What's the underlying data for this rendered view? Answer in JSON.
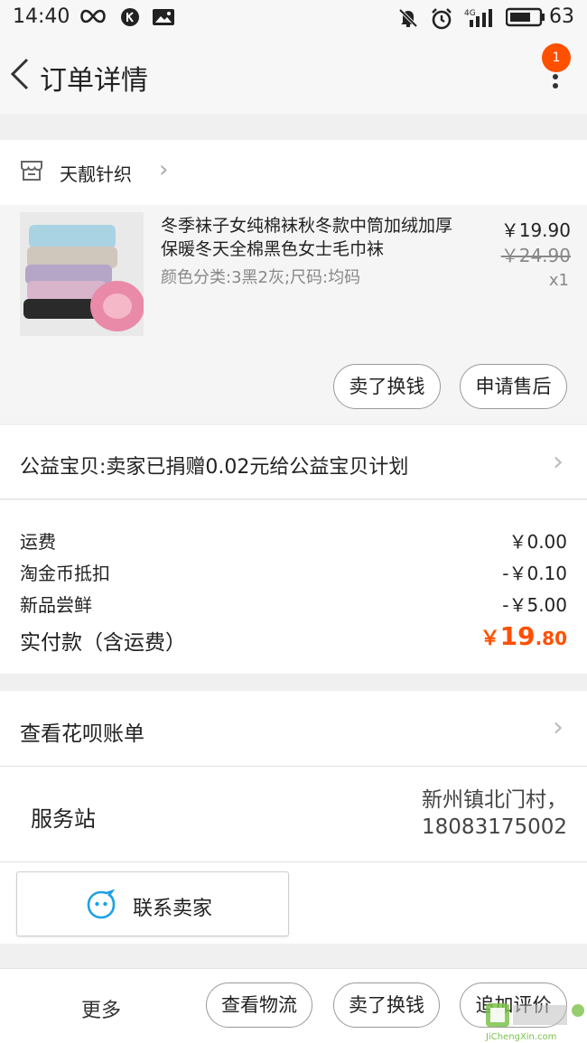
{
  "status_bar": {
    "time": "14:40",
    "battery": "63",
    "icons": [
      "infinity-icon",
      "k-circle-icon",
      "image-notification-icon",
      "mute-bell-icon",
      "alarm-icon",
      "signal-4g-icon",
      "battery-icon"
    ]
  },
  "nav": {
    "title": "订单详情",
    "back_icon": "chevron-left-icon",
    "more_icon": "more-vertical-icon",
    "badge_count": "1"
  },
  "shop": {
    "name": "天靓针织",
    "icon": "store-icon"
  },
  "item": {
    "title": "冬季袜子女纯棉袜秋冬款中筒加绒加厚保暖冬天全棉黑色女士毛巾袜",
    "sku": "颜色分类:3黑2灰;尺码:均码",
    "price": "￥19.90",
    "original_price": "￥24.90",
    "quantity": "x1",
    "buttons": [
      "卖了换钱",
      "申请售后"
    ]
  },
  "charity": {
    "text": "公益宝贝:卖家已捐赠0.02元给公益宝贝计划"
  },
  "fees": {
    "rows": [
      {
        "label": "运费",
        "value": "￥0.00"
      },
      {
        "label": "淘金币抵扣",
        "value": "-￥0.10"
      },
      {
        "label": "新品尝鲜",
        "value": "-￥5.00"
      }
    ],
    "total_label": "实付款（含运费）",
    "total_currency": "￥",
    "total_int": "19",
    "total_dec": ".80"
  },
  "huabei": {
    "text": "查看花呗账单"
  },
  "station": {
    "label": "服务站",
    "address_line1": "新州镇北门村，",
    "address_line2": "18083175002"
  },
  "contact": {
    "label": "联系卖家",
    "icon": "chat-bubble-icon"
  },
  "bottom_bar": {
    "more": "更多",
    "buttons": [
      "查看物流",
      "卖了换钱",
      "追加评价"
    ]
  },
  "watermark": {
    "text": "JiChengXin.com"
  },
  "colors": {
    "accent": "#ff5000",
    "background": "#f0f0f0",
    "card": "#ffffff",
    "item_bg": "#f5f5f5"
  }
}
